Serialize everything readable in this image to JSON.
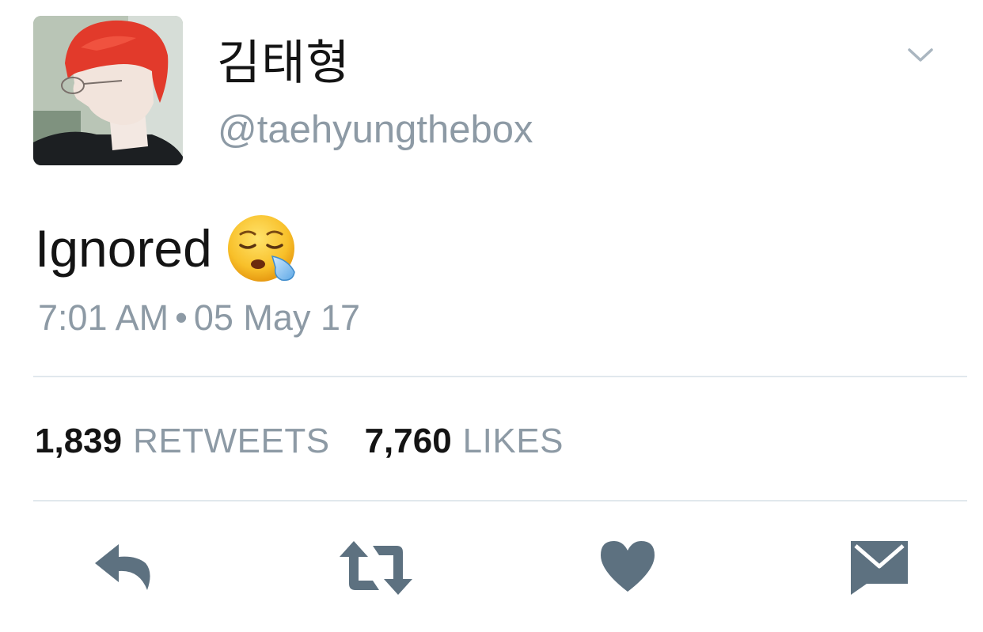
{
  "user": {
    "display_name": "김태형",
    "handle": "@taehyungthebox"
  },
  "tweet": {
    "text": "Ignored",
    "emoji": "sleepy-face-emoji",
    "time": "7:01 AM",
    "separator": "•",
    "date": "05 May 17"
  },
  "stats": {
    "retweets_count": "1,839",
    "retweets_label": "RETWEETS",
    "likes_count": "7,760",
    "likes_label": "LIKES"
  },
  "actions": [
    {
      "icon": "reply-icon"
    },
    {
      "icon": "retweet-icon"
    },
    {
      "icon": "heart-icon"
    },
    {
      "icon": "direct-message-icon"
    }
  ],
  "colors": {
    "text": "#141414",
    "secondary": "#8d9aa5",
    "divider": "#e1e8ed",
    "icons": "#5d7180"
  }
}
